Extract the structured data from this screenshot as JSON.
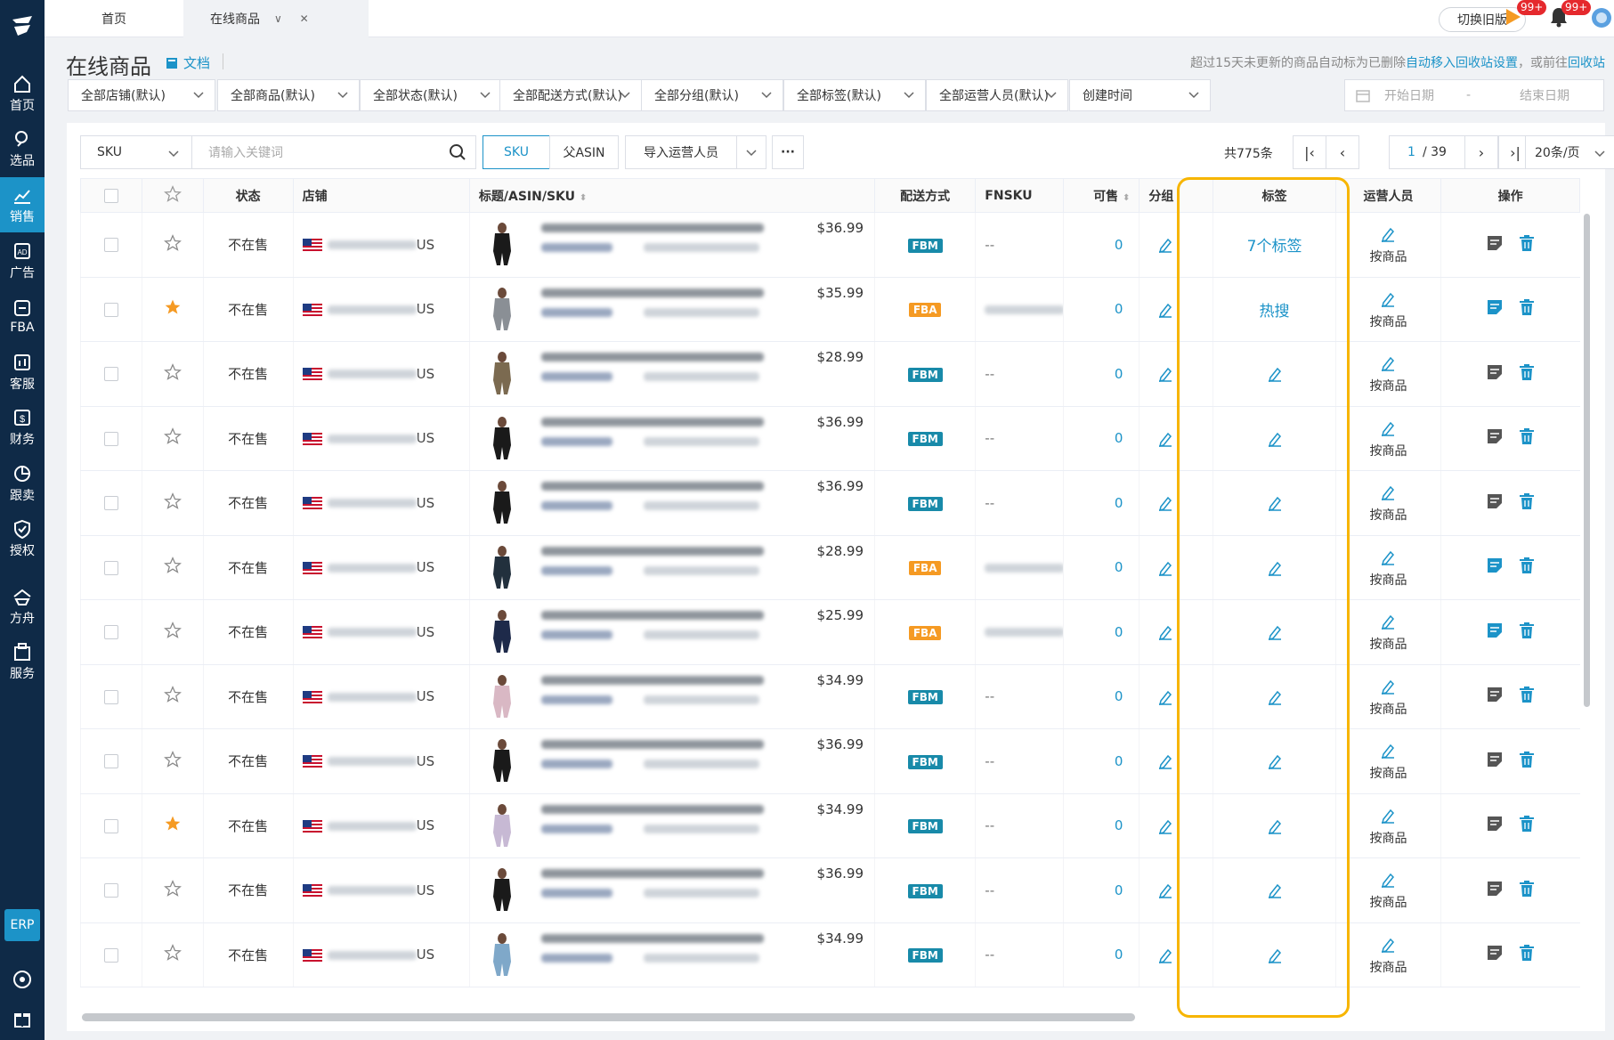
{
  "sidebar": {
    "items": [
      {
        "label": "首页",
        "icon": "home-icon"
      },
      {
        "label": "选品",
        "icon": "search-icon"
      },
      {
        "label": "销售",
        "icon": "sales-chart-icon"
      },
      {
        "label": "广告",
        "icon": "ad-icon"
      },
      {
        "label": "FBA",
        "icon": "fba-icon"
      },
      {
        "label": "客服",
        "icon": "chart-box-icon"
      },
      {
        "label": "财务",
        "icon": "dollar-icon"
      },
      {
        "label": "跟卖",
        "icon": "pie-icon"
      },
      {
        "label": "授权",
        "icon": "shield-icon"
      },
      {
        "label": "方舟",
        "icon": "ark-icon"
      },
      {
        "label": "服务",
        "icon": "service-icon"
      }
    ],
    "active_index": 2,
    "erp_label": "ERP"
  },
  "tabs": [
    {
      "label": "首页"
    },
    {
      "label": "在线商品",
      "ctrl": "∨ ✕"
    }
  ],
  "topbar": {
    "old_version": "切换旧版",
    "badge1": "99+",
    "badge2": "99+"
  },
  "page": {
    "title": "在线商品",
    "doc_link": "文档",
    "notice_text": "超过15天未更新的商品自动标为已删除",
    "notice_link1": "自动移入回收站设置",
    "notice_mid": "，或前往",
    "notice_link2": "回收站"
  },
  "filters": [
    {
      "label": "全部店铺(默认)"
    },
    {
      "label": "全部商品(默认)"
    },
    {
      "label": "全部状态(默认)"
    },
    {
      "label": "全部配送方式(默认)"
    },
    {
      "label": "全部分组(默认)"
    },
    {
      "label": "全部标签(默认)"
    },
    {
      "label": "全部运营人员(默认)"
    },
    {
      "label": "创建时间"
    }
  ],
  "date": {
    "start": "开始日期",
    "sep": "-",
    "end": "结束日期"
  },
  "toolbar": {
    "sku_select": "SKU",
    "keyword_placeholder": "请输入关键词",
    "btn_sku": "SKU",
    "btn_parent_asin": "父ASIN",
    "btn_import": "导入运营人员",
    "btn_more": "···"
  },
  "pagination": {
    "total": "共775条",
    "current": "1",
    "pages": "/ 39",
    "per_page": "20条/页"
  },
  "table": {
    "headers": {
      "status": "状态",
      "store": "店铺",
      "title": "标题/ASIN/SKU",
      "shipping": "配送方式",
      "fnsku": "FNSKU",
      "available": "可售",
      "group": "分组",
      "tag": "标签",
      "operator": "运营人员",
      "action": "操作"
    },
    "rows": [
      {
        "starred": false,
        "status": "不在售",
        "region": "US",
        "price": "$36.99",
        "ship": "FBM",
        "fnsku": "--",
        "avail": "0",
        "tag": "7个标签",
        "op": "按商品",
        "cloth": "#1a1a1a"
      },
      {
        "starred": true,
        "status": "不在售",
        "region": "US",
        "price": "$35.99",
        "ship": "FBA",
        "fnsku": "",
        "avail": "0",
        "tag": "热搜",
        "op": "按商品",
        "cloth": "#8a8f95"
      },
      {
        "starred": false,
        "status": "不在售",
        "region": "US",
        "price": "$28.99",
        "ship": "FBM",
        "fnsku": "--",
        "avail": "0",
        "tag": "",
        "op": "按商品",
        "cloth": "#7b6a50"
      },
      {
        "starred": false,
        "status": "不在售",
        "region": "US",
        "price": "$36.99",
        "ship": "FBM",
        "fnsku": "--",
        "avail": "0",
        "tag": "",
        "op": "按商品",
        "cloth": "#1a1a1a"
      },
      {
        "starred": false,
        "status": "不在售",
        "region": "US",
        "price": "$36.99",
        "ship": "FBM",
        "fnsku": "--",
        "avail": "0",
        "tag": "",
        "op": "按商品",
        "cloth": "#1a1a1a"
      },
      {
        "starred": false,
        "status": "不在售",
        "region": "US",
        "price": "$28.99",
        "ship": "FBA",
        "fnsku": "",
        "avail": "0",
        "tag": "",
        "op": "按商品",
        "cloth": "#22303d"
      },
      {
        "starred": false,
        "status": "不在售",
        "region": "US",
        "price": "$25.99",
        "ship": "FBA",
        "fnsku": "",
        "avail": "0",
        "tag": "",
        "op": "按商品",
        "cloth": "#1e2a4a"
      },
      {
        "starred": false,
        "status": "不在售",
        "region": "US",
        "price": "$34.99",
        "ship": "FBM",
        "fnsku": "--",
        "avail": "0",
        "tag": "",
        "op": "按商品",
        "cloth": "#d9b8c4"
      },
      {
        "starred": false,
        "status": "不在售",
        "region": "US",
        "price": "$36.99",
        "ship": "FBM",
        "fnsku": "--",
        "avail": "0",
        "tag": "",
        "op": "按商品",
        "cloth": "#1a1a1a"
      },
      {
        "starred": true,
        "status": "不在售",
        "region": "US",
        "price": "$34.99",
        "ship": "FBM",
        "fnsku": "--",
        "avail": "0",
        "tag": "",
        "op": "按商品",
        "cloth": "#c7b9d4"
      },
      {
        "starred": false,
        "status": "不在售",
        "region": "US",
        "price": "$36.99",
        "ship": "FBM",
        "fnsku": "--",
        "avail": "0",
        "tag": "",
        "op": "按商品",
        "cloth": "#1a1a1a"
      },
      {
        "starred": false,
        "status": "不在售",
        "region": "US",
        "price": "$34.99",
        "ship": "FBM",
        "fnsku": "--",
        "avail": "0",
        "tag": "",
        "op": "按商品",
        "cloth": "#7fa8c9"
      }
    ]
  },
  "colors": {
    "accent": "#1c93c8",
    "sidebar": "#0f2a47",
    "fba": "#f59a23",
    "fbm": "#188aa9",
    "highlight": "#f7b500",
    "star": "#f59a23"
  }
}
